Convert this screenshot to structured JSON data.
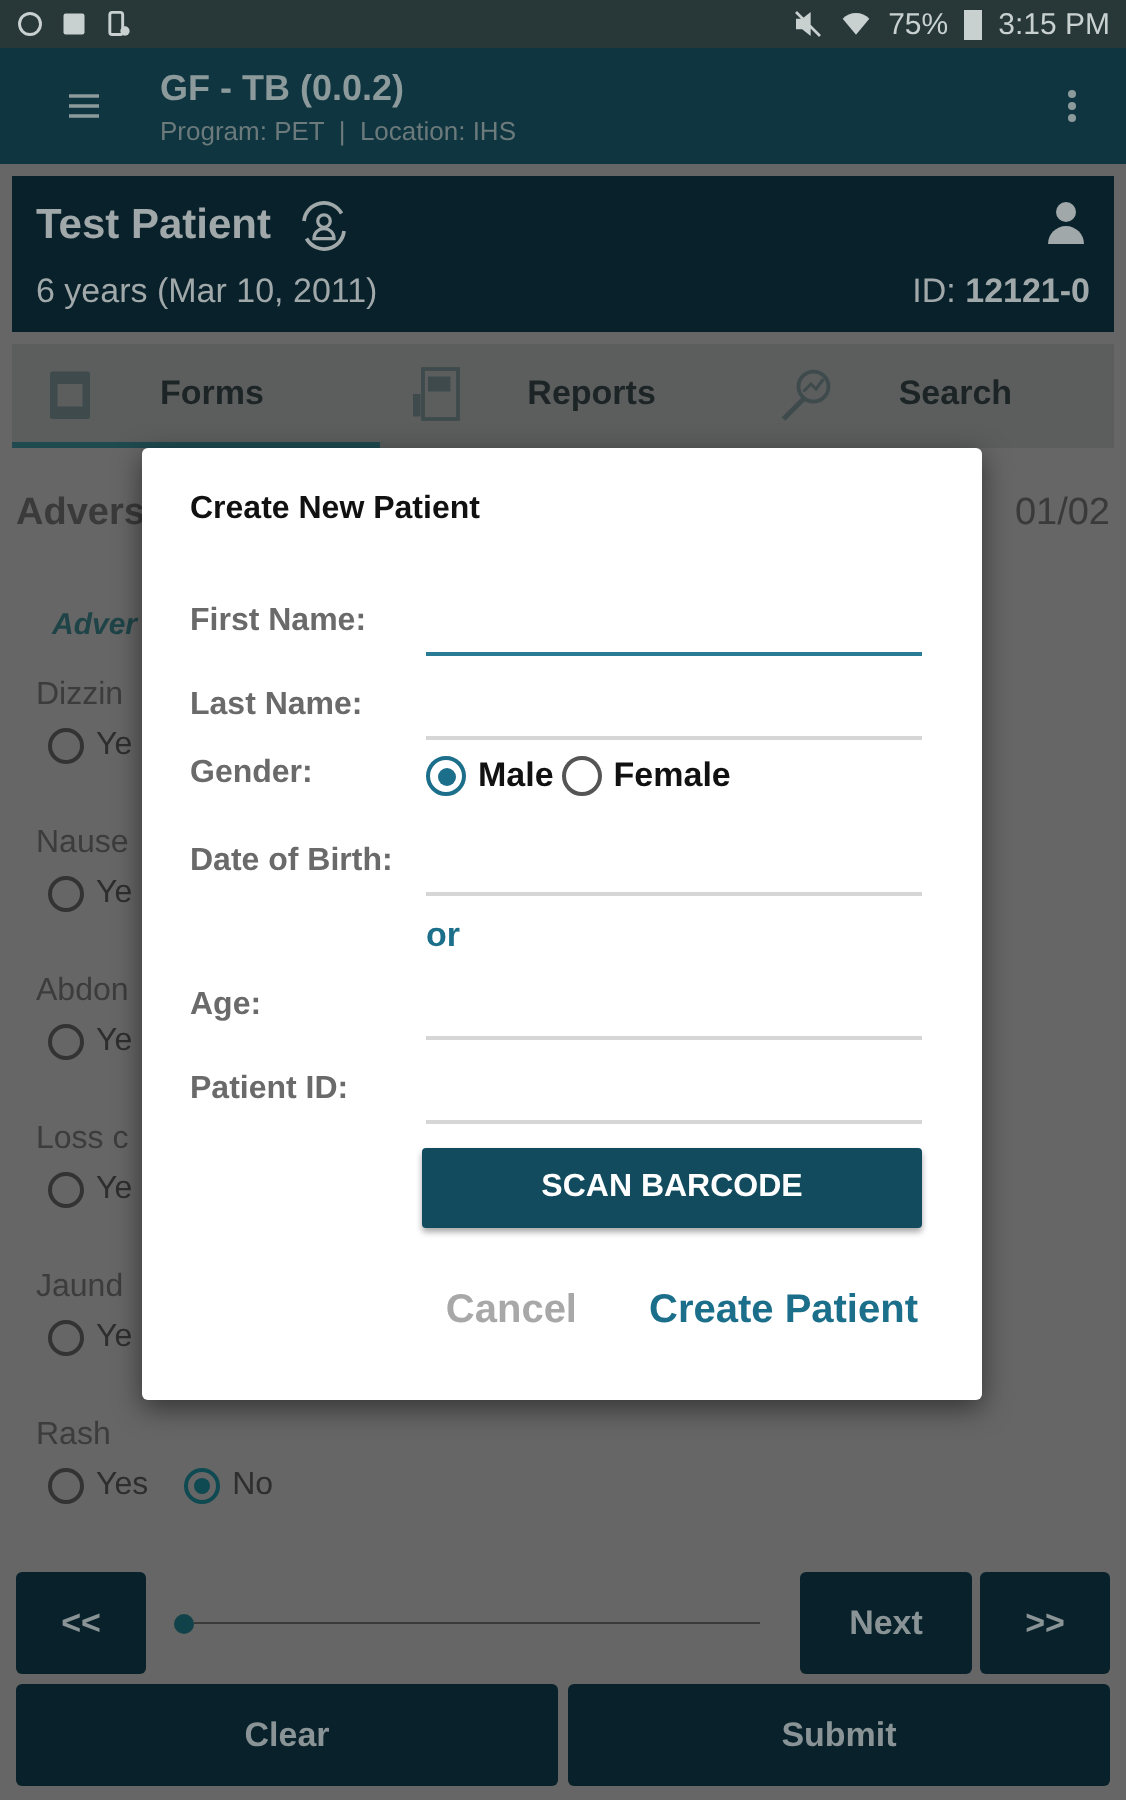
{
  "status_bar": {
    "battery": "75%",
    "time": "3:15 PM"
  },
  "app_bar": {
    "title": "GF - TB (0.0.2)",
    "subtitle": "Program: PET  |  Location: IHS"
  },
  "patient": {
    "name": "Test Patient",
    "age": "6 years (Mar 10, 2011)",
    "id": "ID: **12121-0**"
  },
  "tabs": [
    {
      "label": "Forms",
      "selected": true
    },
    {
      "label": "Reports",
      "selected": false
    },
    {
      "label": "Search",
      "selected": false
    }
  ],
  "form": {
    "title": "Advers",
    "page": "01/02",
    "section": "Adver",
    "questions": [
      {
        "label": "Dizzin",
        "options": [
          {
            "label": "Ye",
            "selected": false
          }
        ]
      },
      {
        "label": "Nause",
        "options": [
          {
            "label": "Ye",
            "selected": false
          }
        ]
      },
      {
        "label": "Abdon",
        "options": [
          {
            "label": "Ye",
            "selected": false
          }
        ]
      },
      {
        "label": "Loss c",
        "options": [
          {
            "label": "Ye",
            "selected": false
          }
        ]
      },
      {
        "label": "Jaund",
        "options": [
          {
            "label": "Ye",
            "selected": false
          }
        ]
      },
      {
        "label": "Rash",
        "options": [
          {
            "label": "Yes",
            "selected": false
          },
          {
            "label": "No",
            "selected": true
          }
        ]
      }
    ]
  },
  "navigation": {
    "first": "<<",
    "next": "Next",
    "last": ">>",
    "progress": {
      "level": 0
    },
    "clear": "Clear",
    "submit": "Submit"
  },
  "dialog": {
    "title": "Create New Patient",
    "fields": [
      {
        "kind": "text",
        "label": "First Name:",
        "focused": true
      },
      {
        "kind": "text",
        "label": "Last Name:",
        "focused": false
      },
      {
        "kind": "radio",
        "label": "Gender:",
        "options": [
          {
            "label": "Male",
            "selected": true
          },
          {
            "label": "Female",
            "selected": false
          }
        ]
      },
      {
        "kind": "text",
        "label": "Date of Birth:",
        "focused": false
      },
      {
        "kind": "separator",
        "label": "or"
      },
      {
        "kind": "text",
        "label": "Age:",
        "focused": false
      },
      {
        "kind": "text",
        "label": "Patient ID:",
        "focused": false
      }
    ],
    "scan_button": "SCAN BARCODE",
    "cancel": "Cancel",
    "confirm": "Create Patient"
  }
}
